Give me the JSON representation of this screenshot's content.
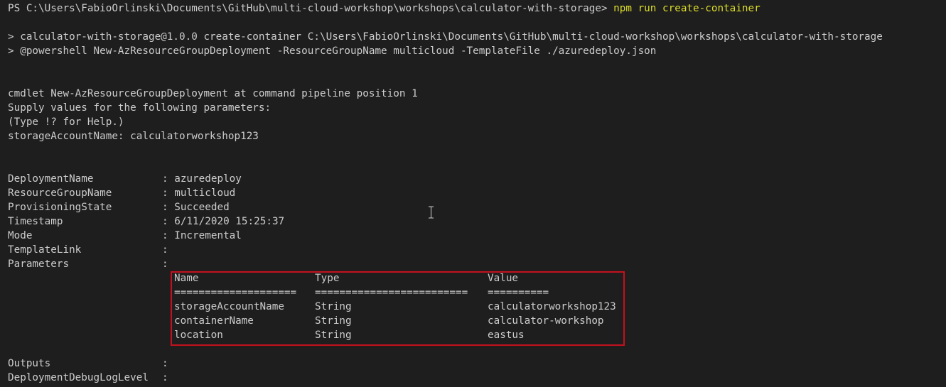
{
  "terminal": {
    "prompt_path": "PS C:\\Users\\FabioOrlinski\\Documents\\GitHub\\multi-cloud-workshop\\workshops\\calculator-with-storage> ",
    "command": "npm run create-container",
    "npm_line_1": "> calculator-with-storage@1.0.0 create-container C:\\Users\\FabioOrlinski\\Documents\\GitHub\\multi-cloud-workshop\\workshops\\calculator-with-storage",
    "npm_line_2": "> @powershell New-AzResourceGroupDeployment -ResourceGroupName multicloud -TemplateFile ./azuredeploy.json",
    "cmdlet_line": "cmdlet New-AzResourceGroupDeployment at command pipeline position 1",
    "supply_line": "Supply values for the following parameters:",
    "help_line": "(Type !? for Help.)",
    "input_prompt": "storageAccountName: calculatorworkshop123"
  },
  "deployment": {
    "fields": [
      {
        "key": "DeploymentName",
        "sep": ": ",
        "value": "azuredeploy"
      },
      {
        "key": "ResourceGroupName",
        "sep": ": ",
        "value": "multicloud"
      },
      {
        "key": "ProvisioningState",
        "sep": ": ",
        "value": "Succeeded"
      },
      {
        "key": "Timestamp",
        "sep": ": ",
        "value": "6/11/2020 15:25:37"
      },
      {
        "key": "Mode",
        "sep": ": ",
        "value": "Incremental"
      },
      {
        "key": "TemplateLink",
        "sep": ":",
        "value": ""
      },
      {
        "key": "Parameters",
        "sep": ":",
        "value": ""
      }
    ],
    "parameters_table": {
      "headers": [
        "Name",
        "Type",
        "Value"
      ],
      "separators": [
        "====================",
        "=========================",
        "=========="
      ],
      "rows": [
        [
          "storageAccountName",
          "String",
          "calculatorworkshop123"
        ],
        [
          "containerName",
          "String",
          "calculator-workshop"
        ],
        [
          "location",
          "String",
          "eastus"
        ]
      ]
    },
    "trailing_fields": [
      {
        "key": "Outputs",
        "sep": ":",
        "value": ""
      },
      {
        "key": "DeploymentDebugLogLevel",
        "sep": ":",
        "value": ""
      }
    ]
  },
  "colors": {
    "background": "#1e1e1e",
    "text": "#cccccc",
    "command_highlight": "#dcdc2a",
    "highlight_box_border": "#c1121f"
  },
  "cursor_icon": "i-beam-cursor-icon"
}
